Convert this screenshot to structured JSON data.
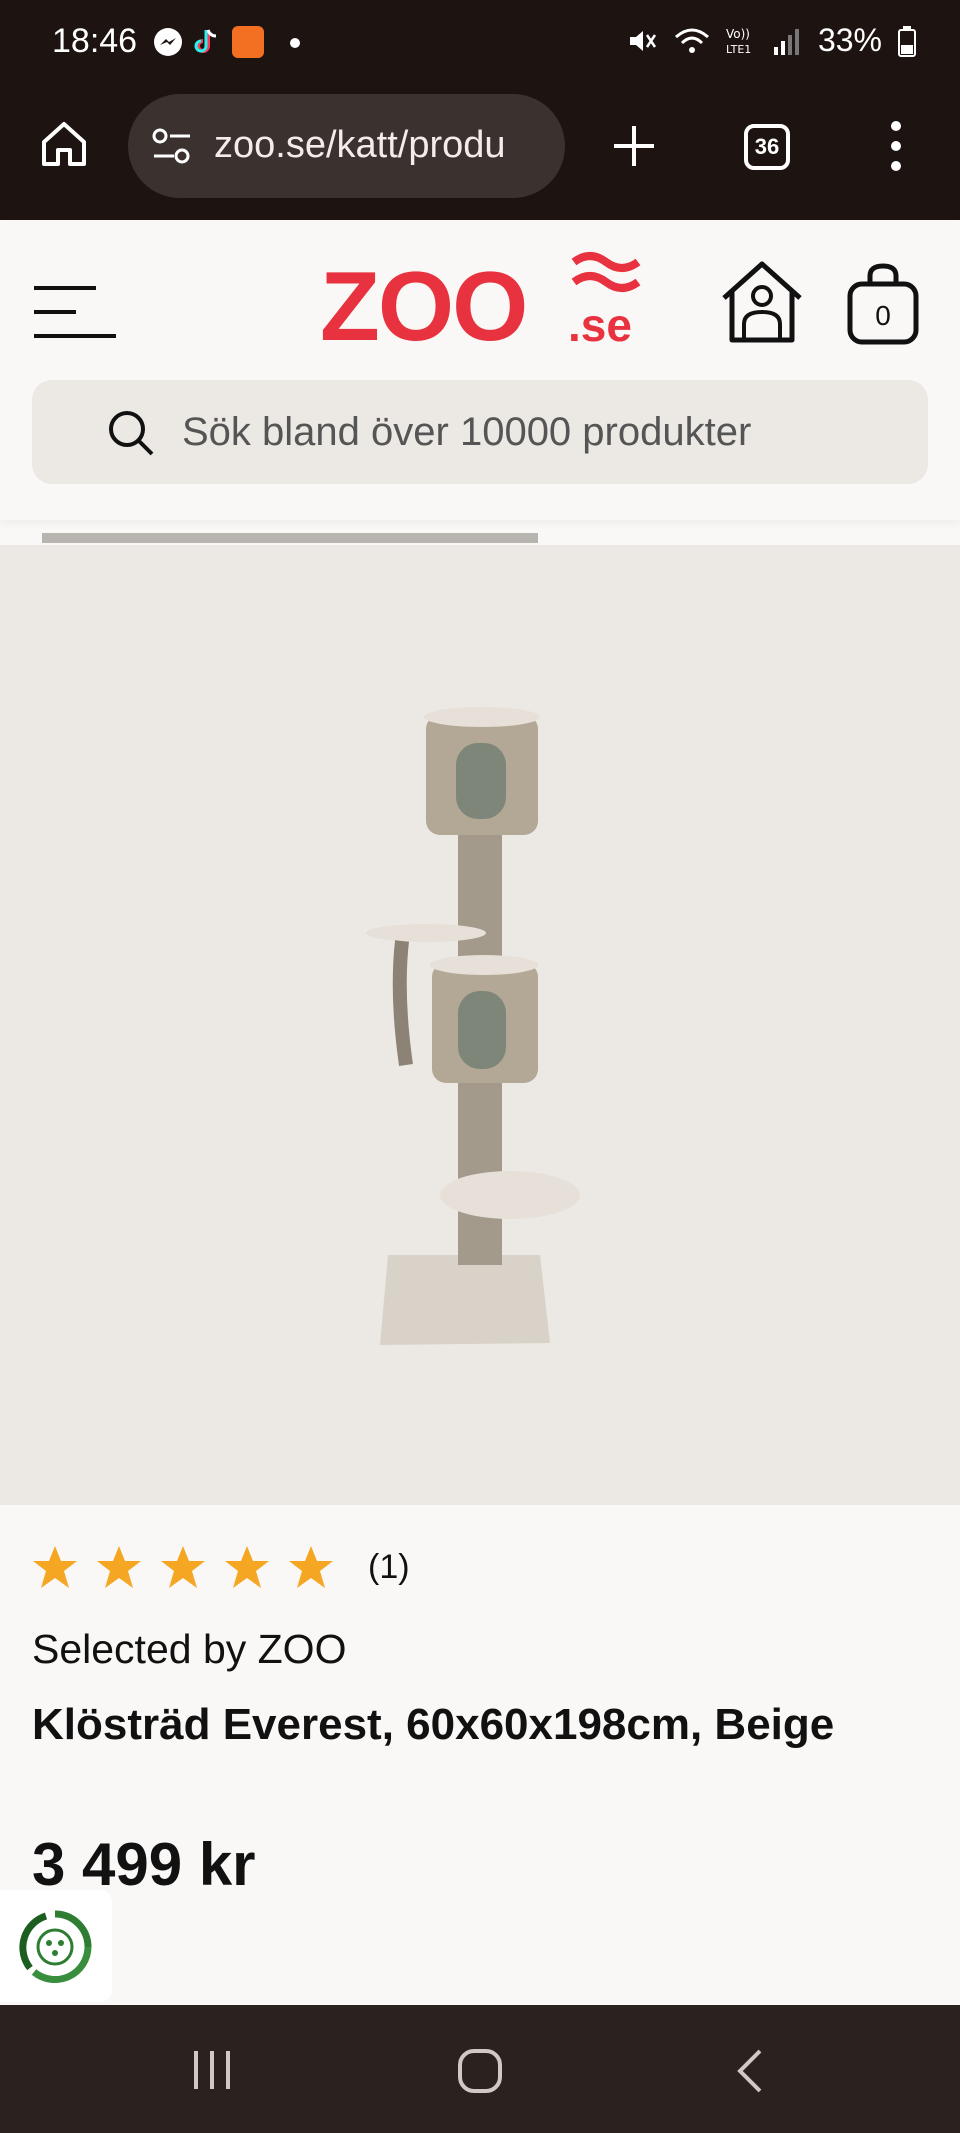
{
  "status_bar": {
    "time": "18:46",
    "battery": "33%",
    "apps": [
      "messenger-icon",
      "tiktok-icon",
      "temu-icon"
    ]
  },
  "browser": {
    "url": "zoo.se/katt/produ",
    "tab_count": "36"
  },
  "header": {
    "logo_text": "ZOO",
    "logo_suffix": ".se",
    "cart_count": "0",
    "search_placeholder": "Sök bland över 10000 produkter"
  },
  "product": {
    "rating_count": "(1)",
    "stars": 5,
    "brand": "Selected by ZOO",
    "title": "Klösträd Everest, 60x60x198cm, Beige",
    "price": "3 499 kr"
  },
  "colors": {
    "brand_red": "#e8323f",
    "star": "#f5a623",
    "dark_bar": "#1d1311"
  }
}
